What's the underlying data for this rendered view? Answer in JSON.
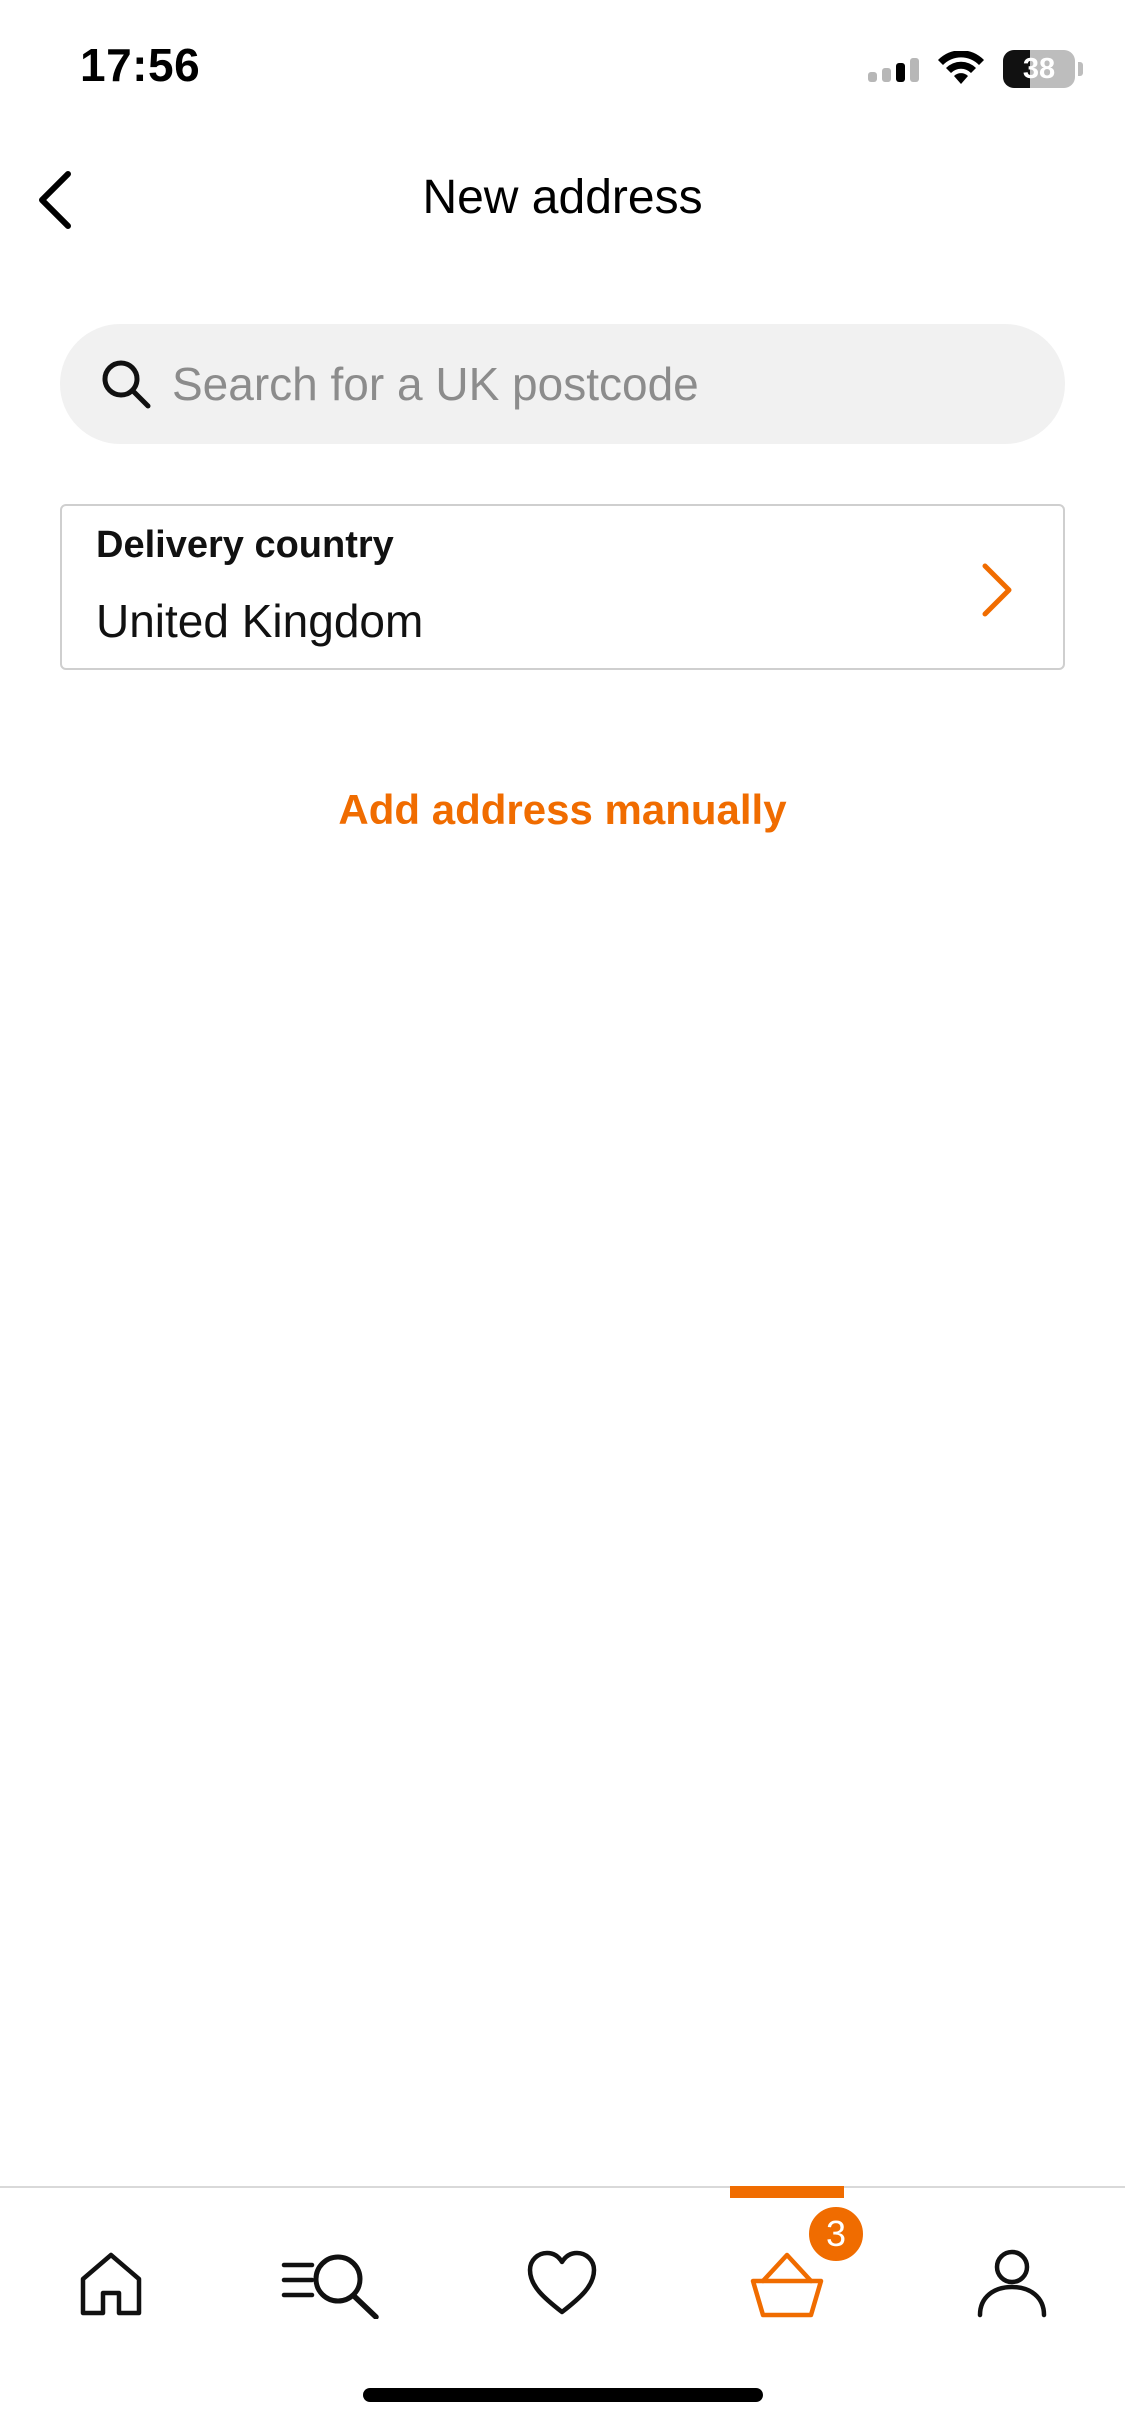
{
  "status_bar": {
    "time": "17:56",
    "battery_level": "38",
    "icons": [
      "cellular-signal-icon",
      "wifi-icon",
      "battery-icon"
    ]
  },
  "header": {
    "title": "New address",
    "back_icon": "chevron-left-icon"
  },
  "search": {
    "placeholder": "Search for a UK postcode",
    "value": "",
    "icon": "search-icon"
  },
  "delivery_country": {
    "label": "Delivery country",
    "value": "United Kingdom",
    "icon": "chevron-right-icon"
  },
  "manual_link": {
    "label": "Add address manually"
  },
  "tab_bar": {
    "items": [
      {
        "name": "home",
        "icon": "home-icon",
        "active": false
      },
      {
        "name": "browse",
        "icon": "menu-search-icon",
        "active": false
      },
      {
        "name": "saved",
        "icon": "heart-icon",
        "active": false
      },
      {
        "name": "basket",
        "icon": "basket-icon",
        "active": true
      },
      {
        "name": "account",
        "icon": "person-icon",
        "active": false
      }
    ],
    "basket_count": "3"
  },
  "colors": {
    "accent": "#f06c00",
    "text": "#111111",
    "placeholder": "#8c8c8c",
    "search_bg": "#f1f1f1",
    "border": "#cfcfcf"
  }
}
